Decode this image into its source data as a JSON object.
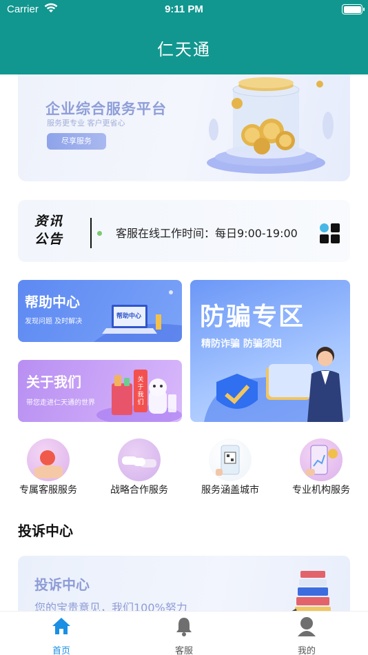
{
  "status_bar": {
    "carrier": "Carrier",
    "time": "9:11 PM"
  },
  "header": {
    "title": "仁天通"
  },
  "banner": {
    "title": "企业综合服务平台",
    "subtitle": "服务更专业 客户更省心",
    "button": "尽享服务"
  },
  "notice": {
    "logo_top": "资讯",
    "logo_bottom": "公告",
    "text": "客服在线工作时间：每日9:00-19:00"
  },
  "cards": {
    "help": {
      "title": "帮助中心",
      "subtitle": "发现问题  及时解决",
      "screen_label": "帮助中心"
    },
    "about": {
      "title": "关于我们",
      "subtitle": "带您走进仁天通的世界",
      "sign": "关于我们"
    },
    "fraud": {
      "title": "防骗专区",
      "subtitle": "精防诈骗  防骗须知"
    }
  },
  "services": [
    {
      "label": "专属客服服务",
      "icon": "hand-fruit-icon"
    },
    {
      "label": "战略合作服务",
      "icon": "handshake-icon"
    },
    {
      "label": "服务涵盖城市",
      "icon": "qr-phone-icon"
    },
    {
      "label": "专业机构服务",
      "icon": "phone-coin-icon"
    }
  ],
  "complaint": {
    "section_title": "投诉中心",
    "title": "投诉中心",
    "subtitle": "您的宝贵意见，我们100%努力"
  },
  "tabs": [
    {
      "label": "首页",
      "icon": "home-icon",
      "active": true
    },
    {
      "label": "客服",
      "icon": "bell-icon",
      "active": false
    },
    {
      "label": "我的",
      "icon": "user-icon",
      "active": false
    }
  ],
  "colors": {
    "primary": "#11978f",
    "tab_active": "#1a8fe3"
  }
}
